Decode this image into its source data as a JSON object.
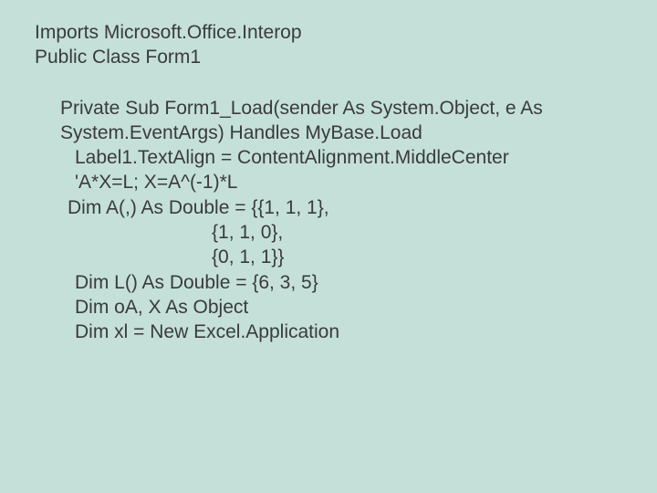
{
  "lines": {
    "l1": "Imports Microsoft.Office.Interop",
    "l2": "Public Class Form1",
    "l3": "Private Sub Form1_Load(sender As System.Object, e As System.EventArgs) Handles MyBase.Load",
    "l4": "Label1.TextAlign = ContentAlignment.MiddleCenter",
    "l5": "'A*X=L; X=A^(-1)*L",
    "l6": "Dim A(,) As Double = {{1, 1, 1},",
    "l7": "{1, 1, 0},",
    "l8": "{0, 1, 1}}",
    "l9": "Dim L() As Double = {6, 3, 5}",
    "l10": "Dim oA, X As Object",
    "l11": "Dim xl = New Excel.Application"
  }
}
